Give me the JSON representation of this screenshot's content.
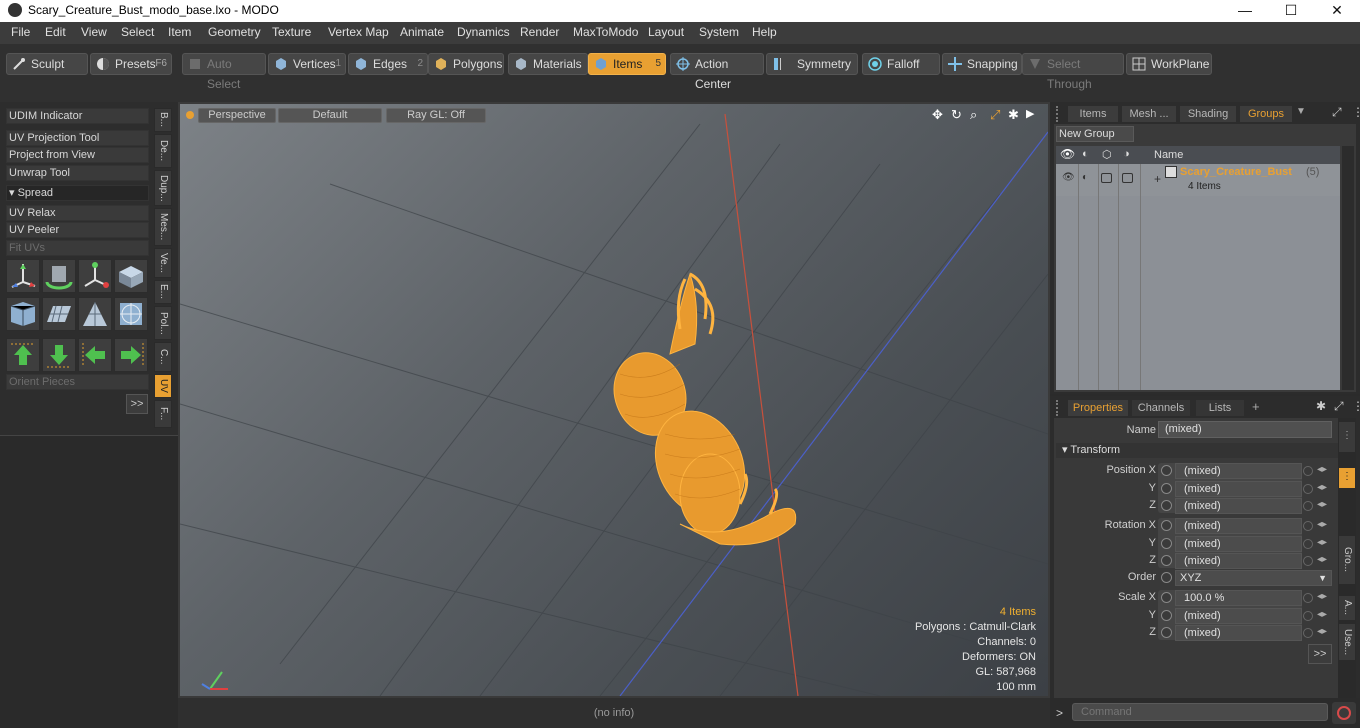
{
  "window": {
    "title": "Scary_Creature_Bust_modo_base.lxo - MODO",
    "minimize": "—",
    "maximize": "☐",
    "close": "✕"
  },
  "menu": [
    "File",
    "Edit",
    "View",
    "Select",
    "Item",
    "Geometry",
    "Texture",
    "Vertex Map",
    "Animate",
    "Dynamics",
    "Render",
    "MaxToModo",
    "Layout",
    "System",
    "Help"
  ],
  "toolbar": {
    "sculpt": "Sculpt",
    "presets": "Presets",
    "presets_key": "F6",
    "auto_select": "Auto Select",
    "vertices": "Vertices",
    "vertices_num": "1",
    "edges": "Edges",
    "edges_num": "2",
    "polygons": "Polygons",
    "materials": "Materials",
    "items": "Items",
    "items_num": "5",
    "action_center": "Action Center",
    "symmetry": "Symmetry",
    "falloff": "Falloff",
    "snapping": "Snapping",
    "select_through": "Select Through",
    "workplane": "WorkPlane",
    "accent_color": "#e8a032"
  },
  "left_panel": {
    "tools": [
      "UDIM Indicator",
      "UV Projection Tool",
      "Project from View",
      "Unwrap Tool"
    ],
    "spread_header": "Spread",
    "tools2": [
      "UV Relax",
      "UV Peeler",
      "Fit UVs"
    ],
    "orient": "Orient Pieces",
    "more": ">>",
    "vtabs": [
      "B...",
      "De...",
      "Dup...",
      "Mes...",
      "Ve...",
      "E...",
      "Pol...",
      "C...",
      "UV",
      "F..."
    ]
  },
  "viewport": {
    "view": "Perspective",
    "shading": "Default",
    "raygl": "Ray GL: Off",
    "stats": {
      "items": "4 Items",
      "polygons": "Polygons : Catmull-Clark",
      "channels": "Channels: 0",
      "deformers": "Deformers: ON",
      "gl": "GL: 587,968",
      "scale": "100 mm"
    },
    "status": "(no info)"
  },
  "groups_panel": {
    "tabs": [
      "Items",
      "Mesh ...",
      "Shading",
      "Groups"
    ],
    "new_group": "New Group",
    "name_header": "Name",
    "group_name": "Scary_Creature_Bust",
    "group_count": "(5)",
    "group_items": "4 Items"
  },
  "properties_panel": {
    "tabs": [
      "Properties",
      "Channels",
      "Lists"
    ],
    "add_tab": "+",
    "name_label": "Name",
    "name_value": "(mixed)",
    "transform_header": "Transform",
    "rows": [
      {
        "label": "Position X",
        "value": "(mixed)"
      },
      {
        "label": "Y",
        "value": "(mixed)"
      },
      {
        "label": "Z",
        "value": "(mixed)"
      },
      {
        "label": "Rotation X",
        "value": "(mixed)"
      },
      {
        "label": "Y",
        "value": "(mixed)"
      },
      {
        "label": "Z",
        "value": "(mixed)"
      },
      {
        "label": "Order",
        "value": "XYZ"
      },
      {
        "label": "Scale X",
        "value": "100.0 %"
      },
      {
        "label": "Y",
        "value": "(mixed)"
      },
      {
        "label": "Z",
        "value": "(mixed)"
      }
    ],
    "more": ">>",
    "side_tabs": [
      "Gro...",
      "A...",
      "Use..."
    ]
  },
  "command": {
    "prompt": ">",
    "placeholder": "Command"
  }
}
